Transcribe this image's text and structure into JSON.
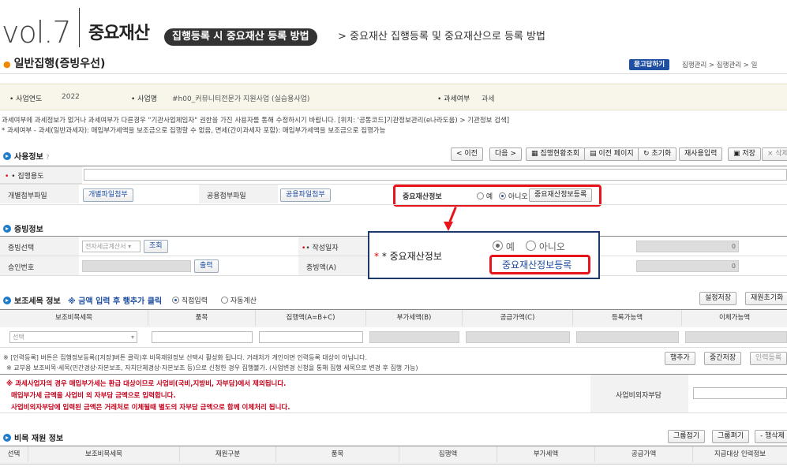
{
  "header": {
    "vol": "vol.7",
    "category": "중요재산",
    "pill": "집행등록 시 중요재산 등록 방법",
    "subtitle": "> 중요재산 집행등록 및 중요재산으로 등록 방법"
  },
  "titlebar": {
    "title": "일반집행(증빙우선)",
    "help_button": "묻고답하기",
    "breadcrumb": "집행관리 > 집행관리 > 일"
  },
  "info": {
    "year_label": "• 사업연도",
    "year_value": "2022",
    "project_label": "• 사업명",
    "project_value": "#h00_커뮤니티전문가 지원사업 (실습용사업)",
    "tax_label": "• 과세여부",
    "tax_value": "과세"
  },
  "notes": {
    "line1": "과세여부에 과세정보가 없거나 과세여부가 다른경우 \"기관사업체임자\" 권한을 가진 사용자를 통해 수정하시기 바랍니다. [위치: '공통코드]기관정보관리(e나라도움) > 기관정보 검색]",
    "line2": "* 과세여부 - 과세(일반과세자): 매입부가세액을 보조금으로 집행할 수 없음, 면세(간이과세자 포함): 매입부가세액을 보조금으로 집행가능"
  },
  "usage": {
    "section": "사용정보",
    "help_mark": "?",
    "buttons": {
      "prev": "< 이전",
      "next": "다음 >",
      "status": "집행현황조회",
      "prev_page": "이전 페이지",
      "reset": "초기화",
      "reuse": "재사용입력",
      "save": "저장",
      "delete": "× 삭제"
    },
    "purpose_label": "• 집행용도",
    "individual_label": "개별첨부파일",
    "individual_btn": "개별파일첨부",
    "common_label": "공용첨부파일",
    "common_btn": "공용파일첨부",
    "asset_label": "중요재산정보",
    "asset_yes": "예",
    "asset_no": "아니오",
    "asset_btn": "중요재산정보등록"
  },
  "evidence": {
    "section": "증빙정보",
    "select_label": "증빙선택",
    "select_value": "전자세금계산서",
    "lookup_btn": "조회",
    "date_label": "• 작성일자",
    "approval_label": "승인번호",
    "print_btn": "출력",
    "amount_label": "증빙액(A)",
    "zero1": "0",
    "zero2": "0"
  },
  "zoom": {
    "label": "* 중요재산정보",
    "yes": "예",
    "no": "아니오",
    "btn": "중요재산정보등록"
  },
  "subitem": {
    "section": "보조세목 정보",
    "hint": "※ 금액 입력 후 행추가 클릭",
    "direct": "직접입력",
    "auto": "자동계산",
    "settings_btn": "설정저장",
    "reset_btn": "재원초기화",
    "columns": [
      "보조비목세목",
      "품목",
      "집행액(A=B+C)",
      "부가세액(B)",
      "공급가액(C)",
      "등록가능액",
      "이체가능액"
    ],
    "select_placeholder": "선택",
    "note1": "※ [인력등록] 버튼은 집행정보등록([저장]버튼 클릭)후 비목재원정보 선택시 활성화 됩니다. 거래처가 개인이면 인력등록 대상이 아닙니다.",
    "note2": "※ 교부용 보조비목·세목(민간경상·자본보조, 자치단체경상·자본보조 등)으로 신청한 경우 집행불가. (사업변경 신청을 통해 집행 세목으로 변경 후 집행 가능)",
    "add_row_btn": "행추가",
    "mid_save_btn": "중간저장",
    "personnel_btn": "인력등록",
    "red1": "※ 과세사업자의 경우 매입부가세는 환급 대상이므로 사업비(국비,지방비, 자부담)에서 제외됩니다.",
    "red2": "매입부가세 금액을 사업비 외 자부담 금액으로 입력합니다.",
    "red3": "사업비외자부담에 입력된 금액은 거래처로 이체될때 별도의 자부담 금액으로 함께 이체처리 됩니다.",
    "self_label": "사업비외자부담"
  },
  "source": {
    "section": "비목 재원 정보",
    "collapse_btn": "그룹접기",
    "expand_btn": "그룹펴기",
    "delete_row_btn": "- 행삭제",
    "columns": [
      "선택",
      "보조비목세목",
      "재원구분",
      "품목",
      "집행액",
      "부가세액",
      "공급가액",
      "지급대상 인력정보"
    ]
  },
  "colors": {
    "accent_blue": "#1e7bc8",
    "highlight_red": "#e8141b",
    "zoom_border": "#1b3a6b"
  }
}
